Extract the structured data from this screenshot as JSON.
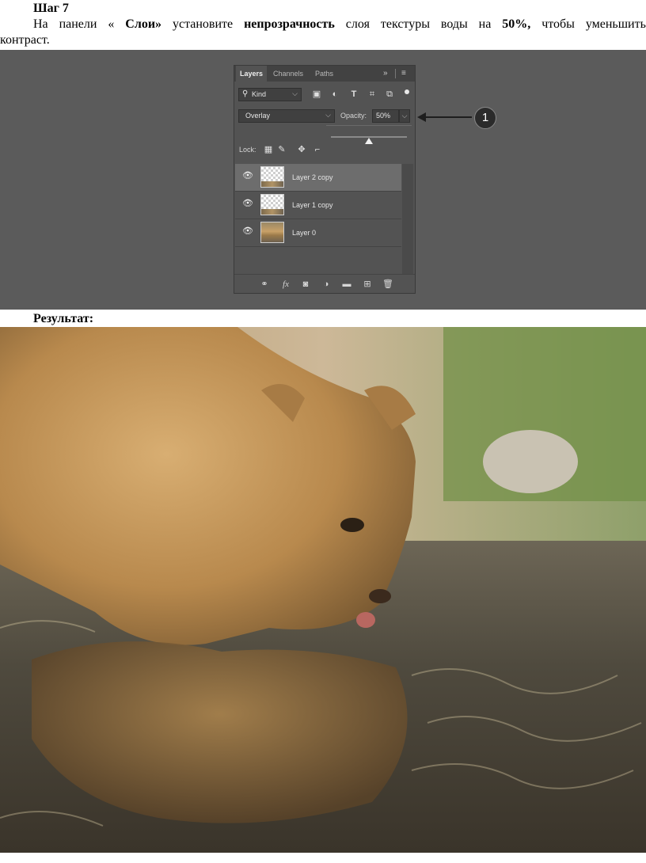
{
  "document": {
    "step_title": "Шаг 7",
    "instruction": {
      "w1": "На",
      "w2": "панели",
      "w3": "«",
      "w4": "Слои»",
      "w5": "установите",
      "w6": "непрозрачность",
      "w7": "слоя",
      "w8": "текстуры",
      "w9": "воды",
      "w10": "на",
      "w11": "50%,",
      "w12": "чтобы",
      "w13": "уменьшить",
      "line2": "контраст."
    },
    "result_label": "Результат:"
  },
  "layers_panel": {
    "tabs": [
      "Layers",
      "Channels",
      "Paths"
    ],
    "tab_more": "»",
    "tab_menu": "≡",
    "filter_kind": "Kind",
    "blend_mode": "Overlay",
    "opacity_label": "Opacity:",
    "opacity_value": "50%",
    "opacity_slider_level": 0.5,
    "lock_label": "Lock:",
    "layers": [
      {
        "name": "Layer 2 copy",
        "selected": true,
        "thumb": "transparent-with-strip"
      },
      {
        "name": "Layer 1 copy",
        "selected": false,
        "thumb": "transparent-with-strip"
      },
      {
        "name": "Layer 0",
        "selected": false,
        "thumb": "lion-photo"
      }
    ],
    "footer_fx": "fx"
  },
  "callout": {
    "number": "1"
  },
  "colors": {
    "panel_bg": "#535353",
    "screenshot_bg": "#5b5b5b",
    "selected_row": "#6d6d6d"
  }
}
